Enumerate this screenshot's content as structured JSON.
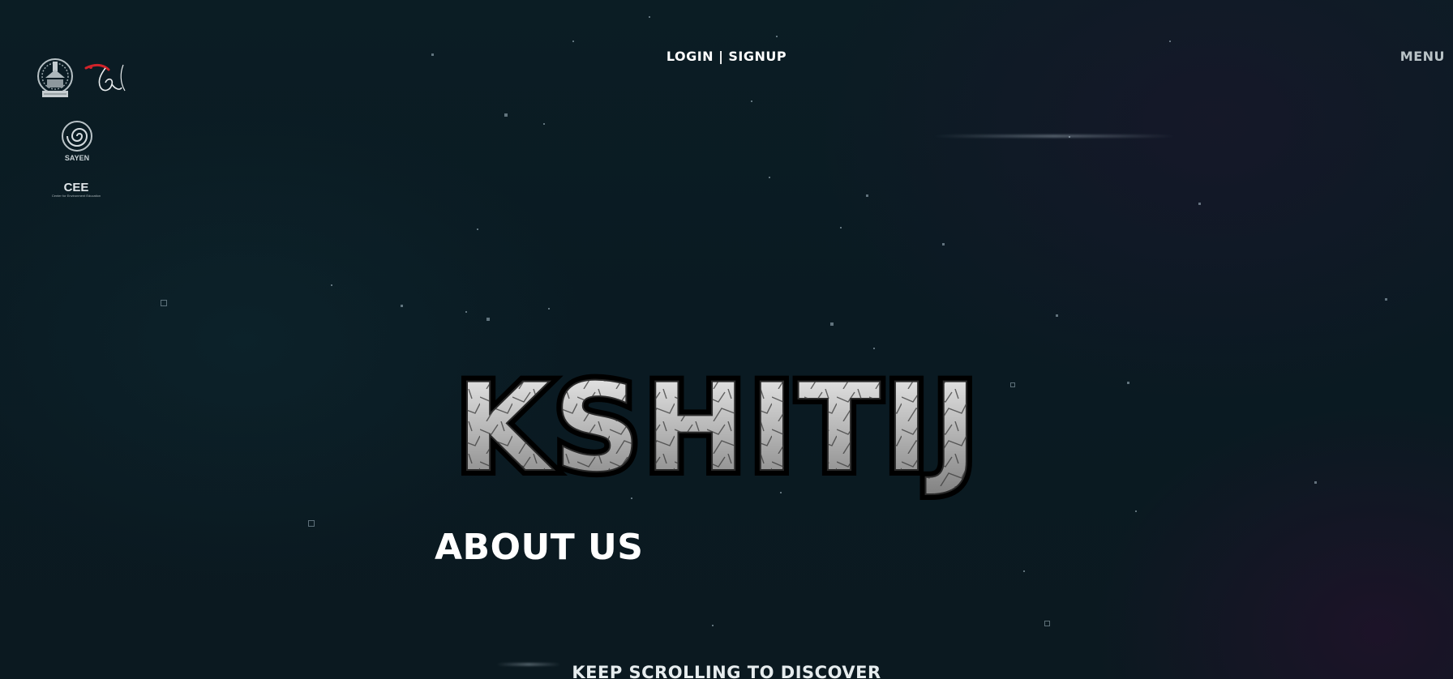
{
  "header": {
    "login_label": "LOGIN",
    "separator": "|",
    "signup_label": "SIGNUP",
    "menu_label": "MENU"
  },
  "logos": {
    "iit_icon": "iit-kgp-emblem-icon",
    "ktj_icon": "kshitij-bird-logo-icon",
    "sayen_caption": "SAYEN",
    "cee_caption": "CEE",
    "cee_subcaption": "Center for Environment Education"
  },
  "hero": {
    "brand_title": "KSHITIJ",
    "section_title": "ABOUT US",
    "scroll_hint": "KEEP SCROLLING TO DISCOVER"
  },
  "colors": {
    "background": "#0a1a20",
    "text": "#ffffff",
    "menu_text": "#b9c3c7",
    "logo_accent": "#d0232a"
  }
}
